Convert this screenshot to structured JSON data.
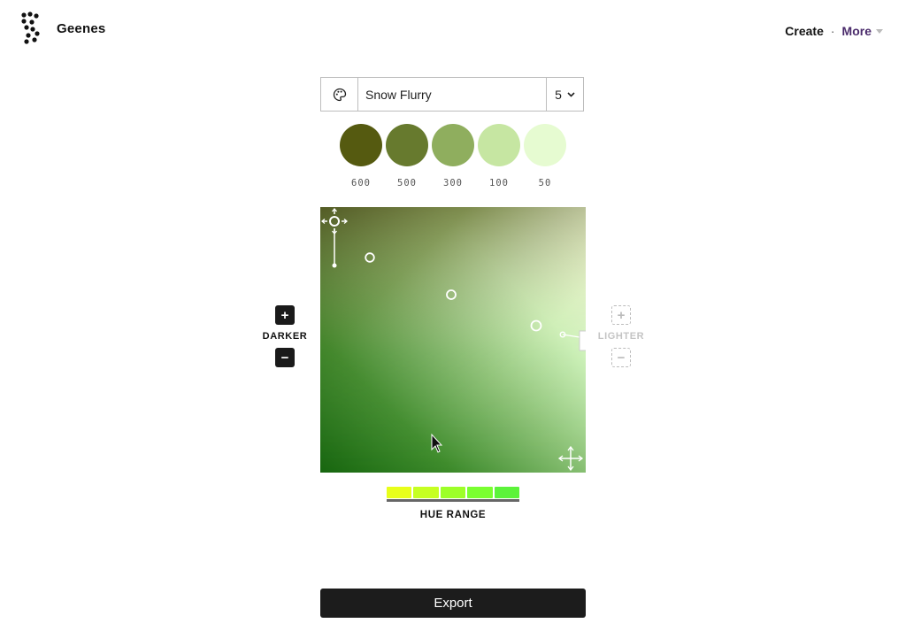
{
  "header": {
    "brand": "Geenes",
    "nav": {
      "create": "Create",
      "separator": "·",
      "more": "More"
    }
  },
  "palette": {
    "icon": "palette-icon",
    "name": "Snow Flurry",
    "count": "5"
  },
  "swatches": [
    {
      "label": "600",
      "color": "#555a10"
    },
    {
      "label": "500",
      "color": "#677a2e"
    },
    {
      "label": "300",
      "color": "#8fae5e"
    },
    {
      "label": "100",
      "color": "#c6e6a2"
    },
    {
      "label": "50",
      "color": "#e6fbd1"
    }
  ],
  "controls": {
    "darker_label": "DARKER",
    "lighter_label": "LIGHTER",
    "plus": "+",
    "minus": "−"
  },
  "hue_range": {
    "label": "HUE RANGE",
    "colors": [
      "#e8ff1a",
      "#c6ff22",
      "#9dff28",
      "#7aff30",
      "#5cf33a"
    ]
  },
  "export_label": "Export"
}
